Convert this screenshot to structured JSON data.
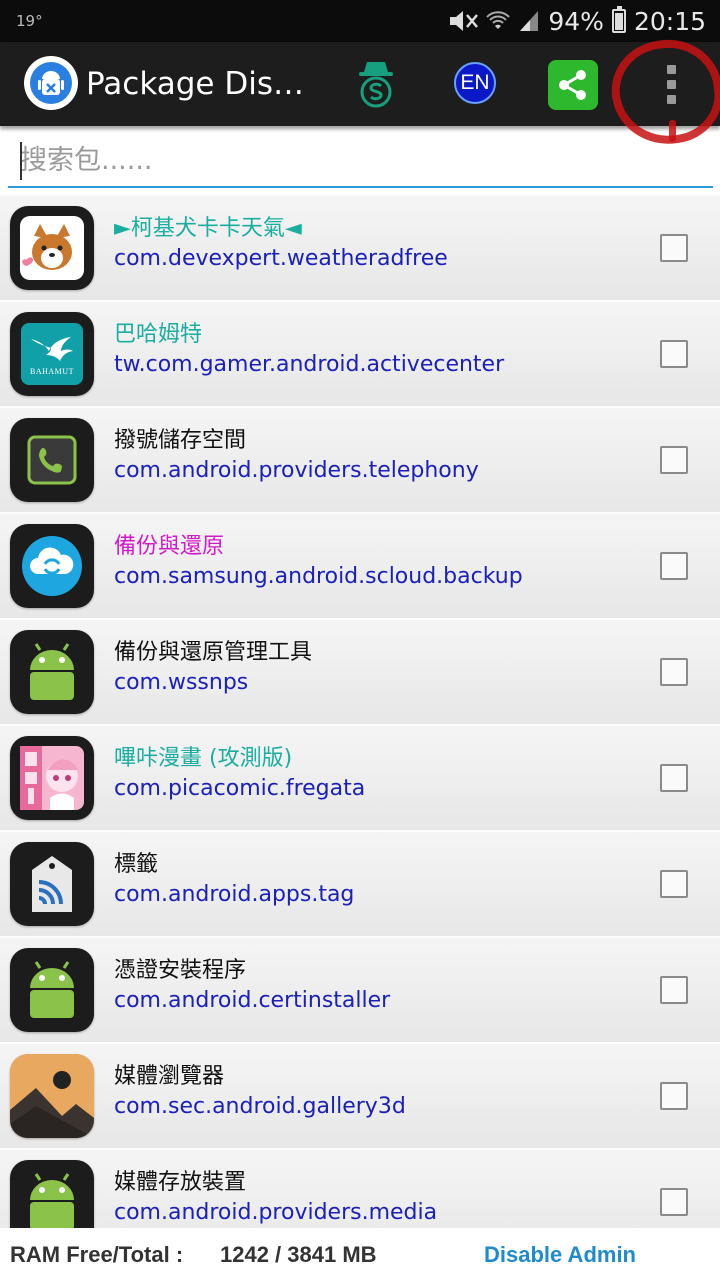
{
  "status_bar": {
    "temperature": "19°",
    "battery": "94%",
    "time": "20:15",
    "icons": [
      "mute-icon",
      "wifi-icon",
      "signal-icon",
      "battery-icon"
    ]
  },
  "app_bar": {
    "title": "Package Disabler Pro",
    "language_button": "EN",
    "icons": [
      "app-logo-icon",
      "s-hat-icon",
      "share-icon",
      "overflow-menu-icon"
    ],
    "share_color": "#2eb82e",
    "language_color": "#0a18c8"
  },
  "search": {
    "placeholder": "搜索包......",
    "value": ""
  },
  "apps": [
    {
      "name": "►柯基犬卡卡天氣◄",
      "package": "com.devexpert.weatheradfree",
      "name_color": "#1aaea0",
      "icon": "corgi-weather-icon",
      "checked": false
    },
    {
      "name": "巴哈姆特",
      "package": "tw.com.gamer.android.activecenter",
      "name_color": "#1aaea0",
      "icon": "bahamut-icon",
      "icon_text": "BAHAMUT",
      "checked": false
    },
    {
      "name": "撥號儲存空間",
      "package": "com.android.providers.telephony",
      "name_color": "#111111",
      "icon": "phone-icon",
      "checked": false
    },
    {
      "name": "備份與還原",
      "package": "com.samsung.android.scloud.backup",
      "name_color": "#d21bc8",
      "icon": "cloud-sync-icon",
      "checked": false
    },
    {
      "name": "備份與還原管理工具",
      "package": "com.wssnps",
      "name_color": "#111111",
      "icon": "android-icon",
      "checked": false
    },
    {
      "name": "嗶咔漫畫 (攻測版)",
      "package": "com.picacomic.fregata",
      "name_color": "#1aaea0",
      "icon": "picacomic-icon",
      "checked": false
    },
    {
      "name": "標籤",
      "package": "com.android.apps.tag",
      "name_color": "#111111",
      "icon": "nfc-tag-icon",
      "checked": false
    },
    {
      "name": "憑證安裝程序",
      "package": "com.android.certinstaller",
      "name_color": "#111111",
      "icon": "android-icon",
      "checked": false
    },
    {
      "name": "媒體瀏覽器",
      "package": "com.sec.android.gallery3d",
      "name_color": "#111111",
      "icon": "gallery-icon",
      "checked": false
    },
    {
      "name": "媒體存放裝置",
      "package": "com.android.providers.media",
      "name_color": "#111111",
      "icon": "android-icon",
      "checked": false
    }
  ],
  "footer": {
    "ram_label": "RAM Free/Total :",
    "ram_value": "1242 / 3841 MB",
    "disable_admin": "Disable Admin"
  }
}
